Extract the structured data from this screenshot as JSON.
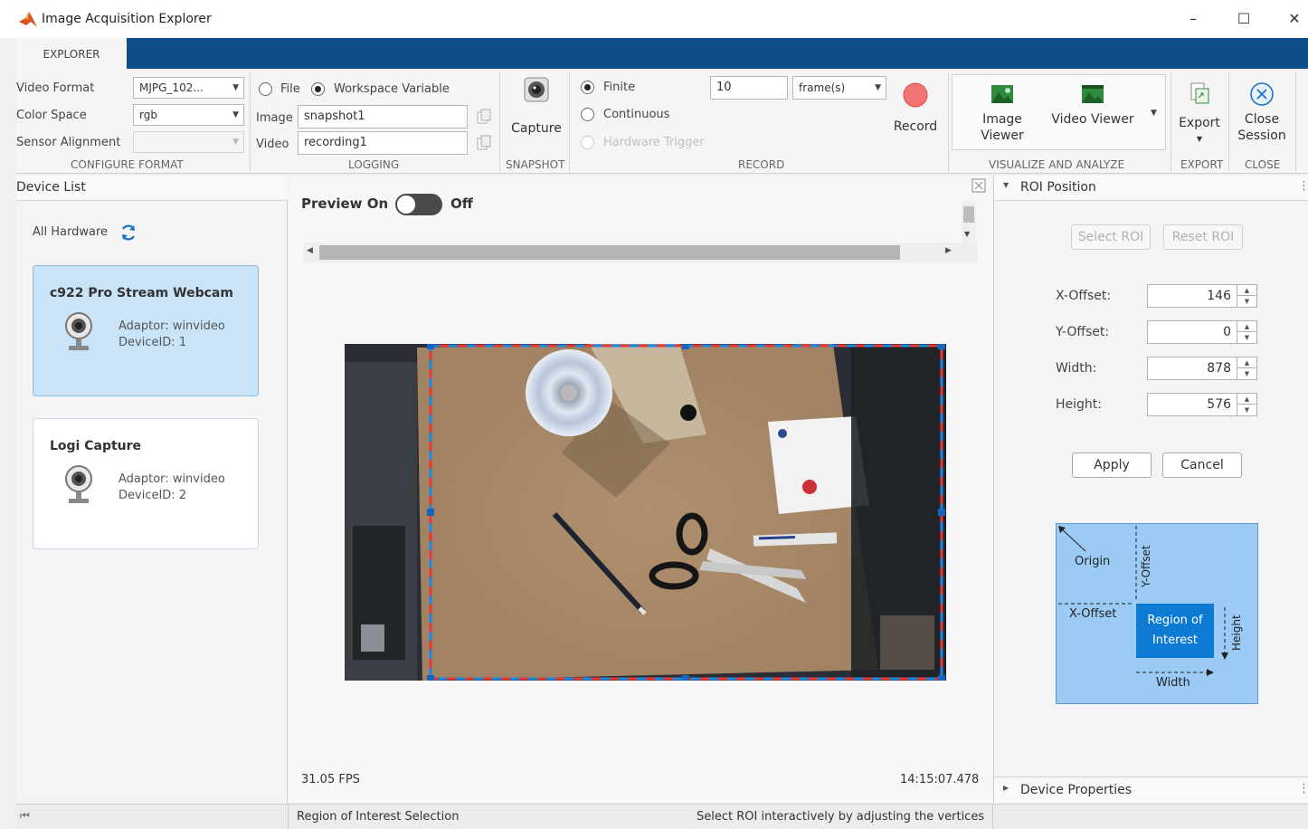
{
  "window": {
    "title": "Image Acquisition Explorer",
    "minimize": "–",
    "maximize": "☐",
    "close": "✕"
  },
  "tab": {
    "label": "EXPLORER"
  },
  "configure_format": {
    "section": "CONFIGURE FORMAT",
    "video_format_label": "Video Format",
    "video_format_value": "MJPG_102...",
    "color_space_label": "Color Space",
    "color_space_value": "rgb",
    "sensor_alignment_label": "Sensor Alignment",
    "sensor_alignment_value": ""
  },
  "logging": {
    "section": "LOGGING",
    "file_label": "File",
    "workspace_label": "Workspace Variable",
    "image_label": "Image",
    "image_value": "snapshot1",
    "video_label": "Video",
    "video_value": "recording1"
  },
  "snapshot": {
    "section": "SNAPSHOT",
    "capture_label": "Capture"
  },
  "record": {
    "section": "RECORD",
    "finite_label": "Finite",
    "continuous_label": "Continuous",
    "hardware_trigger_label": "Hardware Trigger",
    "frames_value": "10",
    "frames_unit": "frame(s)",
    "record_label": "Record"
  },
  "visualize": {
    "section": "VISUALIZE AND ANALYZE",
    "image_viewer_l1": "Image",
    "image_viewer_l2": "Viewer",
    "video_viewer_label": "Video Viewer"
  },
  "export": {
    "section": "EXPORT",
    "export_label": "Export"
  },
  "close_section": {
    "section": "CLOSE",
    "close_l1": "Close",
    "close_l2": "Session"
  },
  "device_list": {
    "title": "Device List",
    "all_hardware": "All Hardware",
    "devices": [
      {
        "name": "c922 Pro Stream Webcam",
        "adaptor": "Adaptor: winvideo",
        "device_id": "DeviceID: 1"
      },
      {
        "name": "Logi Capture",
        "adaptor": "Adaptor: winvideo",
        "device_id": "DeviceID: 2"
      }
    ]
  },
  "preview": {
    "preview_label": "Preview On",
    "off_label": "Off",
    "fps": "31.05 FPS",
    "timestamp": "14:15:07.478"
  },
  "roi": {
    "title": "ROI Position",
    "select_roi": "Select ROI",
    "reset_roi": "Reset ROI",
    "x_offset_label": "X-Offset:",
    "x_offset_value": "146",
    "y_offset_label": "Y-Offset:",
    "y_offset_value": "0",
    "width_label": "Width:",
    "width_value": "878",
    "height_label": "Height:",
    "height_value": "576",
    "apply": "Apply",
    "cancel": "Cancel",
    "diagram": {
      "origin": "Origin",
      "x_offset": "X-Offset",
      "y_offset": "Y-Offset",
      "region_l1": "Region of",
      "region_l2": "Interest",
      "width": "Width",
      "height": "Height"
    }
  },
  "device_properties": {
    "title": "Device Properties"
  },
  "status": {
    "left": "Region of Interest Selection",
    "right": "Select ROI interactively by adjusting the vertices"
  },
  "colors": {
    "tab_bar": "#0e4c8a",
    "selected_card": "#c9e4f8",
    "roi_blue": "#0d7ad4",
    "record_red": "#f05a5a"
  }
}
